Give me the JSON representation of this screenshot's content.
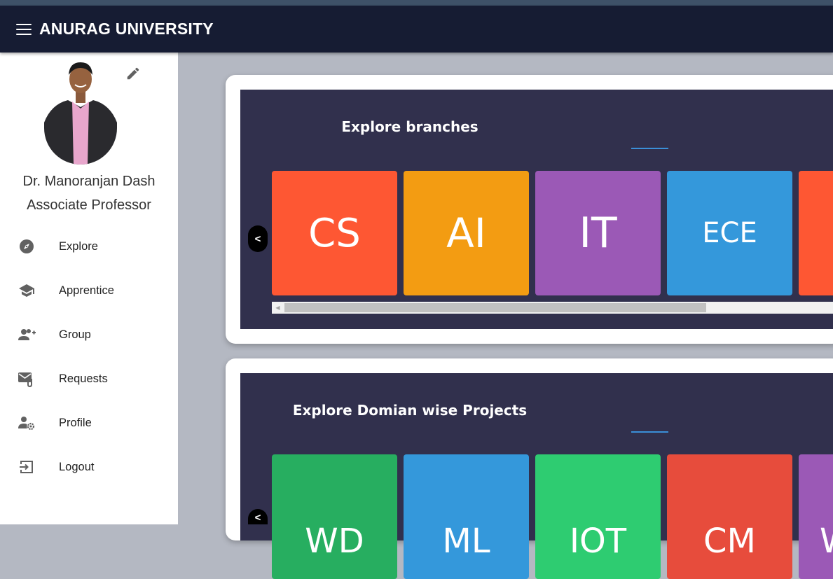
{
  "app": {
    "title": "ANURAG UNIVERSITY"
  },
  "user": {
    "name": "Dr. Manoranjan Dash",
    "role": "Associate Professor"
  },
  "nav": [
    {
      "label": "Explore",
      "icon": "compass-icon"
    },
    {
      "label": "Apprentice",
      "icon": "graduation-cap-icon"
    },
    {
      "label": "Group",
      "icon": "add-group-icon"
    },
    {
      "label": "Requests",
      "icon": "mail-attach-icon"
    },
    {
      "label": "Profile",
      "icon": "user-gear-icon"
    },
    {
      "label": "Logout",
      "icon": "logout-icon"
    }
  ],
  "branches": {
    "title": "Explore branches",
    "prev_label": "<",
    "tiles": [
      {
        "label": "CS",
        "color": "#fe5733"
      },
      {
        "label": "AI",
        "color": "#f39c12"
      },
      {
        "label": "IT",
        "color": "#9b59b6"
      },
      {
        "label": "ECE",
        "color": "#3498db"
      },
      {
        "label": "",
        "color": "#fe5733"
      }
    ]
  },
  "domains": {
    "title": "Explore Domian wise Projects",
    "prev_label": "<",
    "tiles": [
      {
        "label": "WD",
        "color": "#27ae60"
      },
      {
        "label": "ML",
        "color": "#3498db"
      },
      {
        "label": "IOT",
        "color": "#2ecc71"
      },
      {
        "label": "CM",
        "color": "#e74c3c"
      },
      {
        "label": "W",
        "color": "#9b59b6"
      }
    ]
  }
}
